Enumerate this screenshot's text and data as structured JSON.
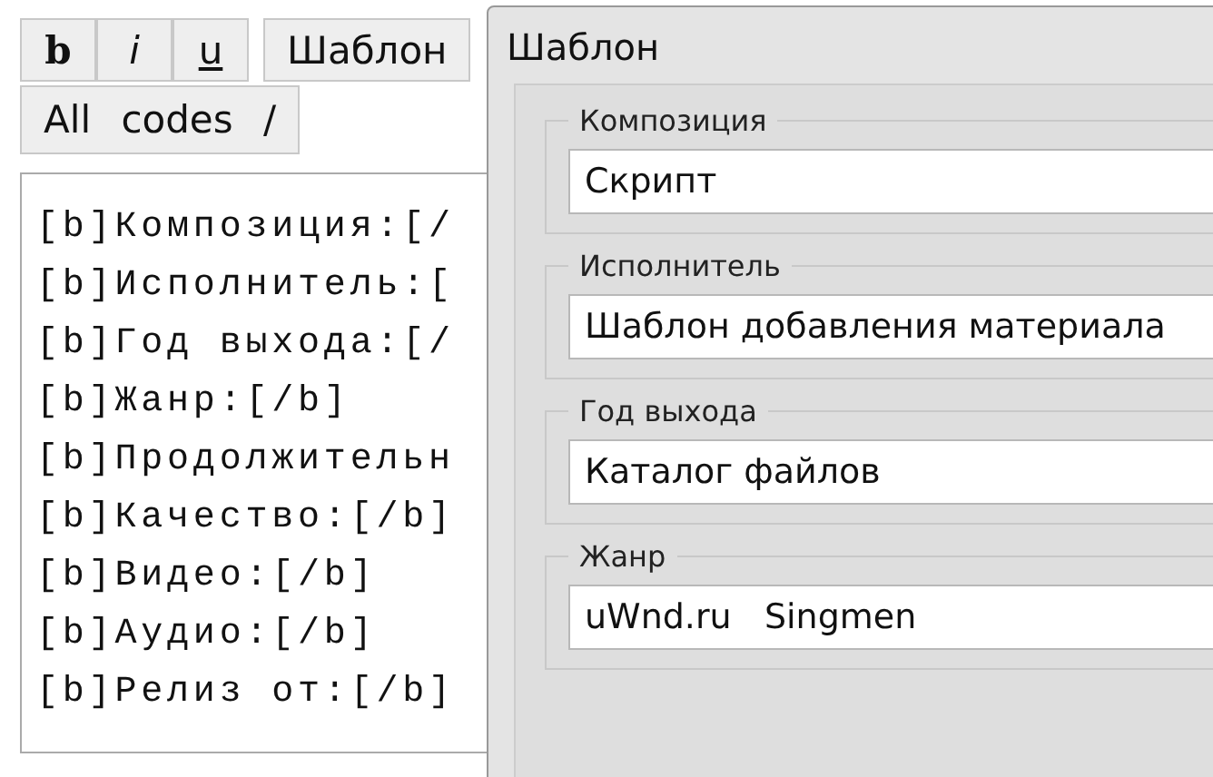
{
  "toolbar": {
    "format_buttons": [
      {
        "label": "b",
        "kind": "bold"
      },
      {
        "label": "i",
        "kind": "italic"
      },
      {
        "label": "u",
        "kind": "underline"
      }
    ],
    "template_button": "Шаблон",
    "codes_button": "All codes /"
  },
  "editor": {
    "lines": [
      "[b]Композиция:[/",
      "[b]Исполнитель:[",
      "[b]Год выхода:[/",
      "[b]Жанр:[/b]",
      "[b]Продолжительн",
      "[b]Качество:[/b]",
      "[b]Видео:[/b]",
      "[b]Аудио:[/b]",
      "[b]Релиз от:[/b]"
    ]
  },
  "dialog": {
    "title": "Шаблон",
    "fields": [
      {
        "label": "Композиция",
        "value": "Скрипт"
      },
      {
        "label": "Исполнитель",
        "value": "Шаблон добавления материала"
      },
      {
        "label": "Год выхода",
        "value": "Каталог файлов"
      },
      {
        "label": "Жанр",
        "value": "uWnd.ru   Singmen"
      }
    ]
  }
}
